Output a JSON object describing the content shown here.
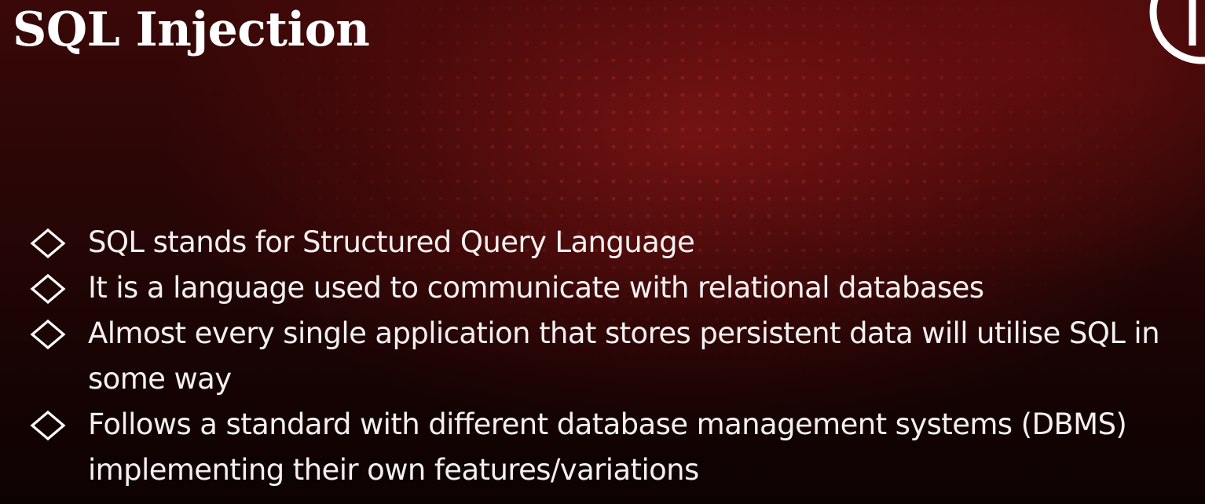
{
  "slide": {
    "title": "SQL Injection",
    "bullets": [
      "SQL stands for Structured Query Language",
      "It is a language used to communicate with relational databases",
      "Almost every single application that stores persistent data will utilise SQL in some way",
      "Follows a standard with different database management systems (DBMS) implementing their own features/variations"
    ],
    "bullet_icon": "diamond-outline-icon",
    "logo_icon": "circle-logo-icon"
  },
  "colors": {
    "background_dark": "#140303",
    "background_red": "#aa1c1c",
    "text": "#ffffff"
  }
}
